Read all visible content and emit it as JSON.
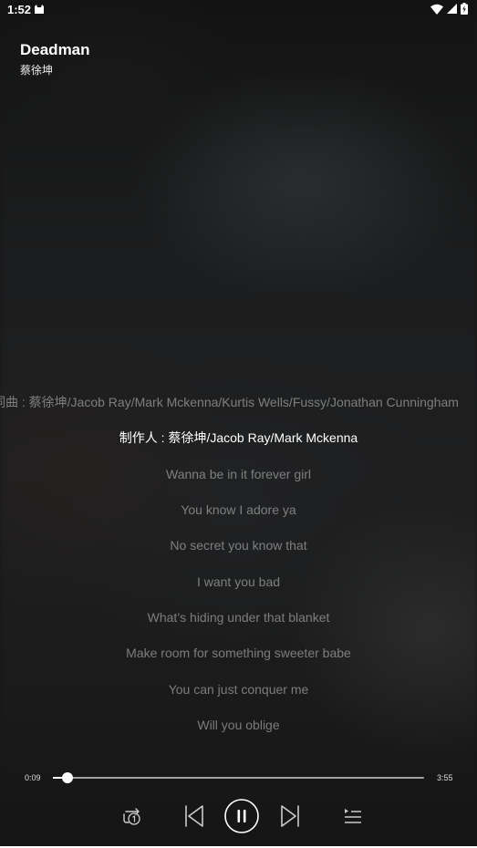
{
  "status_bar": {
    "time": "1:52",
    "app_icon": "android-cat-icon",
    "wifi_icon": "wifi-icon",
    "signal_icon": "cell-signal-icon",
    "battery_icon": "battery-icon"
  },
  "song": {
    "title": "Deadman",
    "artist": "蔡徐坤"
  },
  "lyrics": [
    {
      "text": "词曲 : 蔡徐坤/Jacob Ray/Mark Mckenna/Kurtis Wells/Fussy/Jonathan Cunningham",
      "active": false
    },
    {
      "text": "制作人 : 蔡徐坤/Jacob Ray/Mark Mckenna",
      "active": true
    },
    {
      "text": "Wanna be in it forever girl",
      "active": false
    },
    {
      "text": "You know I adore ya",
      "active": false
    },
    {
      "text": "No secret you know that",
      "active": false
    },
    {
      "text": "I want you bad",
      "active": false
    },
    {
      "text": "What’s hiding under that blanket",
      "active": false
    },
    {
      "text": "Make room for something sweeter babe",
      "active": false
    },
    {
      "text": "You can just conquer me",
      "active": false
    },
    {
      "text": "Will you oblige",
      "active": false
    }
  ],
  "player": {
    "current_time": "0:09",
    "total_time": "3:55",
    "progress_fraction": 0.04,
    "controls": {
      "repeat_icon": "repeat-one-icon",
      "previous_icon": "skip-previous-icon",
      "pause_icon": "pause-icon",
      "next_icon": "skip-next-icon",
      "playlist_icon": "playlist-icon"
    }
  },
  "colors": {
    "background": "#161616",
    "active_lyric": "#ffffff",
    "inactive_lyric": "#8a8a8a"
  }
}
